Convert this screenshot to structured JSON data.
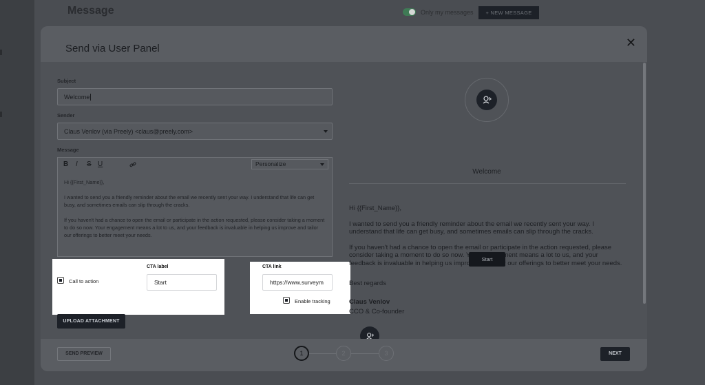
{
  "background": {
    "page_title": "Message",
    "toggle_label": "Only my messages",
    "new_message_label": "+  NEW MESSAGE"
  },
  "modal": {
    "title": "Send via User Panel",
    "close_glyph": "✕"
  },
  "form": {
    "subject_label": "Subject",
    "subject_value": "Welcome",
    "sender_label": "Sender",
    "sender_value": "Claus Venlov (via Preely) <claus@preely.com>",
    "message_label": "Message",
    "toolbar": {
      "bold": "B",
      "italic": "I",
      "strike": "S",
      "underline": "U",
      "link_icon": "link-icon",
      "personalize": "Personalize"
    },
    "message_body": [
      "Hi {{First_Name}},",
      "I wanted to send you a friendly reminder about the email we recently sent your way. I understand that life can get busy, and sometimes emails can slip through the cracks.",
      "If you haven't had a chance to open the email or participate in the action requested, please consider taking a moment to do so now. Your engagement means a lot to us, and your feedback is invaluable in helping us improve and tailor our offerings to better meet your needs."
    ],
    "cta_checkbox_label": "Call to action",
    "cta_label_title": "CTA label",
    "cta_label_value": "Start",
    "cta_link_title": "CTA link",
    "cta_link_value": "https://www.surveym",
    "enable_tracking_label": "Enable tracking",
    "upload_label": "UPLOAD ATTACHMENT"
  },
  "preview": {
    "subject": "Welcome",
    "body": [
      "Hi {{First_Name}},",
      "I wanted to send you a friendly reminder about the email we recently sent your way. I understand that life can get busy, and sometimes emails can slip through the cracks.",
      "If you haven't had a chance to open the email or participate in the action requested, please consider taking a moment to do so now. Your engagement means a lot to us, and your feedback is invaluable in helping us improve and tailor our offerings to better meet your needs."
    ],
    "cta_button": "Start",
    "regards": "Best regards",
    "signer_name": "Claus Venlov",
    "signer_role": "CCO & Co-founder"
  },
  "footer": {
    "send_preview_label": "SEND PREVIEW",
    "steps": [
      "1",
      "2",
      "3"
    ],
    "active_step": 1,
    "next_label": "NEXT"
  },
  "colors": {
    "dark_button": "#1d2128",
    "highlight_panel": "#ffffff",
    "toggle_on": "#3f7a55"
  }
}
